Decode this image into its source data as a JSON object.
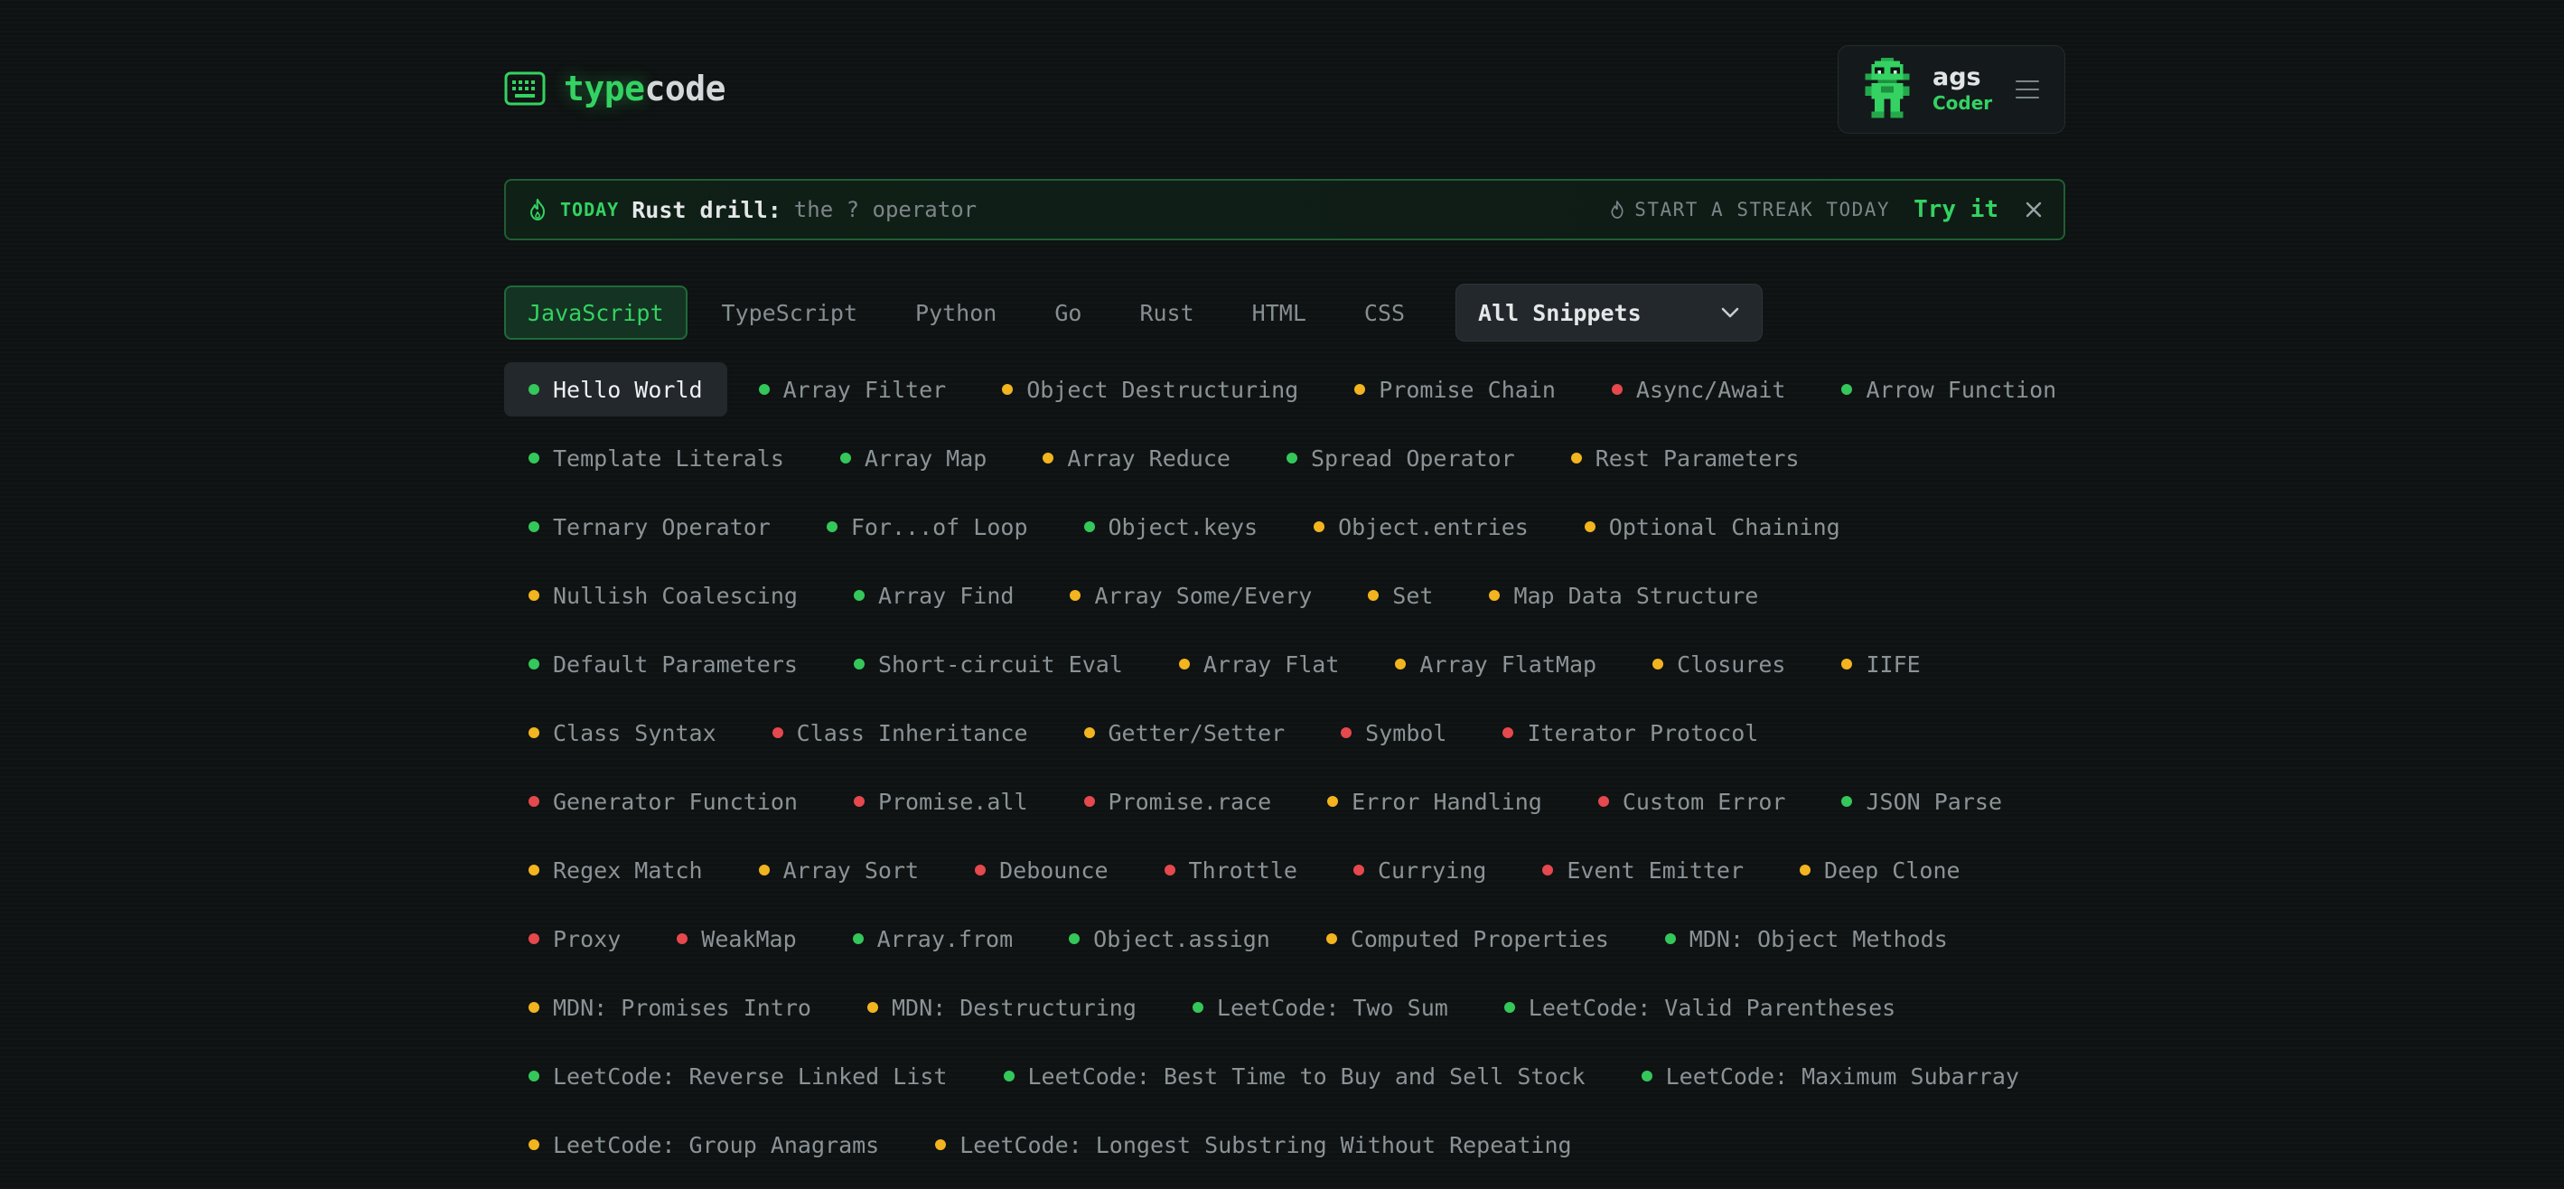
{
  "brand": {
    "part1": "type",
    "part2": "code",
    "icon": "keyboard-icon",
    "accent_color": "#34d262"
  },
  "user": {
    "name": "ags",
    "role": "Coder",
    "avatar_icon": "pixel-robot-avatar",
    "menu_icon": "hamburger-menu-icon"
  },
  "banner": {
    "flame_icon": "flame-icon",
    "today": "TODAY",
    "drill": "Rust drill:",
    "topic": "the ? operator",
    "streak": "START A STREAK TODAY",
    "cta": "Try it",
    "close_icon": "close-icon"
  },
  "tabs": [
    {
      "label": "JavaScript",
      "active": true
    },
    {
      "label": "TypeScript",
      "active": false
    },
    {
      "label": "Python",
      "active": false
    },
    {
      "label": "Go",
      "active": false
    },
    {
      "label": "Rust",
      "active": false
    },
    {
      "label": "HTML",
      "active": false
    },
    {
      "label": "CSS",
      "active": false
    }
  ],
  "filter": {
    "selected": "All Snippets",
    "icon": "chevron-down-icon"
  },
  "difficulty_colors": {
    "easy": "#34c75a",
    "medium": "#f2b41f",
    "hard": "#e5484d"
  },
  "snippet_rows": [
    [
      {
        "label": "Hello World",
        "level": "easy",
        "selected": true
      },
      {
        "label": "Array Filter",
        "level": "easy"
      },
      {
        "label": "Object Destructuring",
        "level": "medium"
      },
      {
        "label": "Promise Chain",
        "level": "medium"
      },
      {
        "label": "Async/Await",
        "level": "hard"
      },
      {
        "label": "Arrow Function",
        "level": "easy"
      }
    ],
    [
      {
        "label": "Template Literals",
        "level": "easy"
      },
      {
        "label": "Array Map",
        "level": "easy"
      },
      {
        "label": "Array Reduce",
        "level": "medium"
      },
      {
        "label": "Spread Operator",
        "level": "easy"
      },
      {
        "label": "Rest Parameters",
        "level": "medium"
      }
    ],
    [
      {
        "label": "Ternary Operator",
        "level": "easy"
      },
      {
        "label": "For...of Loop",
        "level": "easy"
      },
      {
        "label": "Object.keys",
        "level": "easy"
      },
      {
        "label": "Object.entries",
        "level": "medium"
      },
      {
        "label": "Optional Chaining",
        "level": "medium"
      }
    ],
    [
      {
        "label": "Nullish Coalescing",
        "level": "medium"
      },
      {
        "label": "Array Find",
        "level": "easy"
      },
      {
        "label": "Array Some/Every",
        "level": "medium"
      },
      {
        "label": "Set",
        "level": "medium"
      },
      {
        "label": "Map Data Structure",
        "level": "medium"
      }
    ],
    [
      {
        "label": "Default Parameters",
        "level": "easy"
      },
      {
        "label": "Short-circuit Eval",
        "level": "easy"
      },
      {
        "label": "Array Flat",
        "level": "medium"
      },
      {
        "label": "Array FlatMap",
        "level": "medium"
      },
      {
        "label": "Closures",
        "level": "medium"
      },
      {
        "label": "IIFE",
        "level": "medium"
      }
    ],
    [
      {
        "label": "Class Syntax",
        "level": "medium"
      },
      {
        "label": "Class Inheritance",
        "level": "hard"
      },
      {
        "label": "Getter/Setter",
        "level": "medium"
      },
      {
        "label": "Symbol",
        "level": "hard"
      },
      {
        "label": "Iterator Protocol",
        "level": "hard"
      }
    ],
    [
      {
        "label": "Generator Function",
        "level": "hard"
      },
      {
        "label": "Promise.all",
        "level": "hard"
      },
      {
        "label": "Promise.race",
        "level": "hard"
      },
      {
        "label": "Error Handling",
        "level": "medium"
      },
      {
        "label": "Custom Error",
        "level": "hard"
      },
      {
        "label": "JSON Parse",
        "level": "easy"
      }
    ],
    [
      {
        "label": "Regex Match",
        "level": "medium"
      },
      {
        "label": "Array Sort",
        "level": "medium"
      },
      {
        "label": "Debounce",
        "level": "hard"
      },
      {
        "label": "Throttle",
        "level": "hard"
      },
      {
        "label": "Currying",
        "level": "hard"
      },
      {
        "label": "Event Emitter",
        "level": "hard"
      },
      {
        "label": "Deep Clone",
        "level": "medium"
      }
    ],
    [
      {
        "label": "Proxy",
        "level": "hard"
      },
      {
        "label": "WeakMap",
        "level": "hard"
      },
      {
        "label": "Array.from",
        "level": "easy"
      },
      {
        "label": "Object.assign",
        "level": "easy"
      },
      {
        "label": "Computed Properties",
        "level": "medium"
      },
      {
        "label": "MDN: Object Methods",
        "level": "easy"
      }
    ],
    [
      {
        "label": "MDN: Promises Intro",
        "level": "medium"
      },
      {
        "label": "MDN: Destructuring",
        "level": "medium"
      },
      {
        "label": "LeetCode: Two Sum",
        "level": "easy"
      },
      {
        "label": "LeetCode: Valid Parentheses",
        "level": "easy"
      }
    ],
    [
      {
        "label": "LeetCode: Reverse Linked List",
        "level": "easy"
      },
      {
        "label": "LeetCode: Best Time to Buy and Sell Stock",
        "level": "easy"
      },
      {
        "label": "LeetCode: Maximum Subarray",
        "level": "easy"
      }
    ],
    [
      {
        "label": "LeetCode: Group Anagrams",
        "level": "medium"
      },
      {
        "label": "LeetCode: Longest Substring Without Repeating",
        "level": "medium"
      }
    ]
  ]
}
